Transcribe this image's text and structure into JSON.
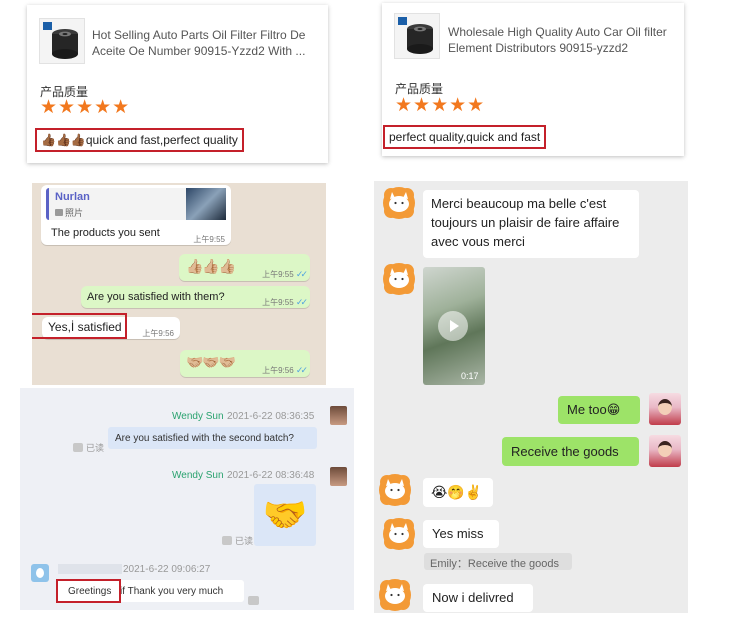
{
  "colors": {
    "star": "#f2781e",
    "highlight_border": "#c4202a",
    "whatsapp_bg": "#e9dfd3",
    "whatsapp_out": "#dcf7c6",
    "wechat_name": "#2aa26f",
    "wechat_bubble": "#dbe6f7",
    "fr_out_bubble": "#9de368"
  },
  "review_cards": [
    {
      "title": "Hot Selling Auto Parts Oil Filter Filtro De Aceite Oe Number 90915-Yzzd2 With ...",
      "quality_label": "产品质量",
      "stars": "★★★★★",
      "comment_emoji": "👍🏾👍🏾👍🏾",
      "comment": "quick and fast,perfect quality"
    },
    {
      "title": "Wholesale High Quality Auto Car Oil filter Element Distributors 90915-yzzd2 90915...",
      "quality_label": "产品质量",
      "stars": "★★★★★",
      "comment": "perfect quality,quick and fast"
    }
  ],
  "whatsapp": {
    "quote_name": "Nurlan",
    "quote_type": "照片",
    "msg1": "The products you sent",
    "msg1_time": "上午9:55",
    "msg2_emoji": "👍🏼👍🏼👍🏼",
    "msg2_time": "上午9:55",
    "msg3": "Are you satisfied with them?",
    "msg3_time": "上午9:55",
    "msg4": "Yes,İ satisfied",
    "msg4_time": "上午9:56",
    "msg5_emoji": "🤝🏼🤝🏼🤝🏼",
    "msg5_time": "上午9:56",
    "ticks": "✓✓"
  },
  "wechat": {
    "sender1": "Wendy Sun",
    "time1": "2021-6-22 08:36:35",
    "msg1": "Are you satisfied with the second batch?",
    "read1": "已读",
    "sender2": "Wendy Sun",
    "time2": "2021-6-22 08:36:48",
    "msg2_emoji": "🤝",
    "read2": "已读",
    "time3": "2021-6-22 09:06:27",
    "msg3_highlight": "Greetings",
    "msg3_rest": "if Thank you very much"
  },
  "french_chat": {
    "msg1": "Merci beaucoup ma belle c'est toujours un plaisir de faire affaire avec vous merci",
    "video_duration": "0:17",
    "out1": "Me too😁",
    "out2": "Receive the goods",
    "msg2_emoji": "😭🤭✌️",
    "msg3": "Yes miss",
    "quote": "Emily：Receive the goods",
    "msg4": "Now i delivred"
  }
}
